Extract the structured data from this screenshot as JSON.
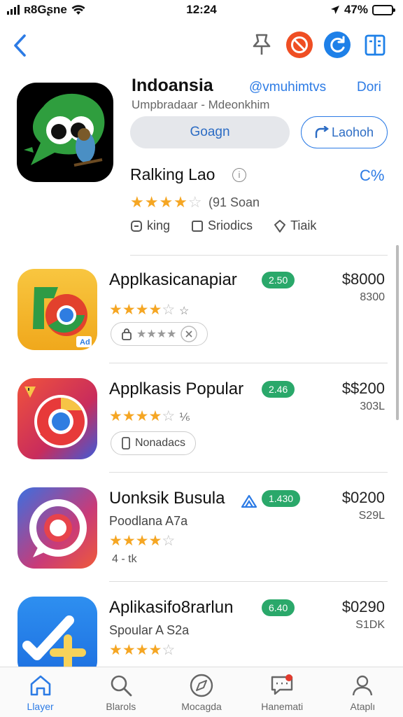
{
  "status_bar": {
    "carrier": "ʀ8Gʂne",
    "time": "12:24",
    "battery": "47%",
    "battery_level": 0.47
  },
  "header": {
    "app_title": "Indoansia",
    "developer": "@vmuhimtvs",
    "developer_link": "Dori",
    "subtitle": "Umpbradaar - Mdeonkhim",
    "get_label": "Goagn",
    "share_label": "Laohoh",
    "rating_title": "Ralking Lao",
    "percent": "C%",
    "rating": 4,
    "reviews": "(91 Soan",
    "tags": [
      "king",
      "Sriodics",
      "Tiaik"
    ]
  },
  "apps": [
    {
      "name": "Applkasicanapiar",
      "badge": "2.50",
      "price": "$8000",
      "price_sub": "8300",
      "rating": 4,
      "rating_tail": "☆",
      "pill": "★★★★",
      "icon": "chrome-yellow-icon"
    },
    {
      "name": "Applkasis Popular",
      "badge": "2.46",
      "price": "$$200",
      "price_sub": "303L",
      "rating": 4,
      "rating_tail": "⅙",
      "pill": "Nonadacs",
      "icon": "chrome-red-icon"
    },
    {
      "name": "Uonksik Busula",
      "badge": "1.430",
      "price": "$0200",
      "price_sub": "S29L",
      "subtitle": "Poodlana A7a",
      "rating": 4,
      "note": "4 ‑ tk",
      "icon": "camera-ring-icon"
    },
    {
      "name": "Aplikasifo8rarlun",
      "badge": "6.40",
      "price": "$0290",
      "price_sub": "S1DK",
      "subtitle": "Spoular A S2a",
      "rating": 4,
      "icon": "check-plus-icon"
    }
  ],
  "tabs": [
    {
      "label": "Llayer",
      "icon": "home-icon",
      "active": true
    },
    {
      "label": "Blarols",
      "icon": "search-icon",
      "active": false
    },
    {
      "label": "Mocagda",
      "icon": "compass-icon",
      "active": false
    },
    {
      "label": "Hanemati",
      "icon": "message-icon",
      "active": false
    },
    {
      "label": "Ataplı",
      "icon": "person-icon",
      "active": false
    }
  ],
  "colors": {
    "accent": "#2c7be5",
    "badge_green": "#2aa86a",
    "star": "#f5a623",
    "notify_red": "#e23b2e"
  }
}
